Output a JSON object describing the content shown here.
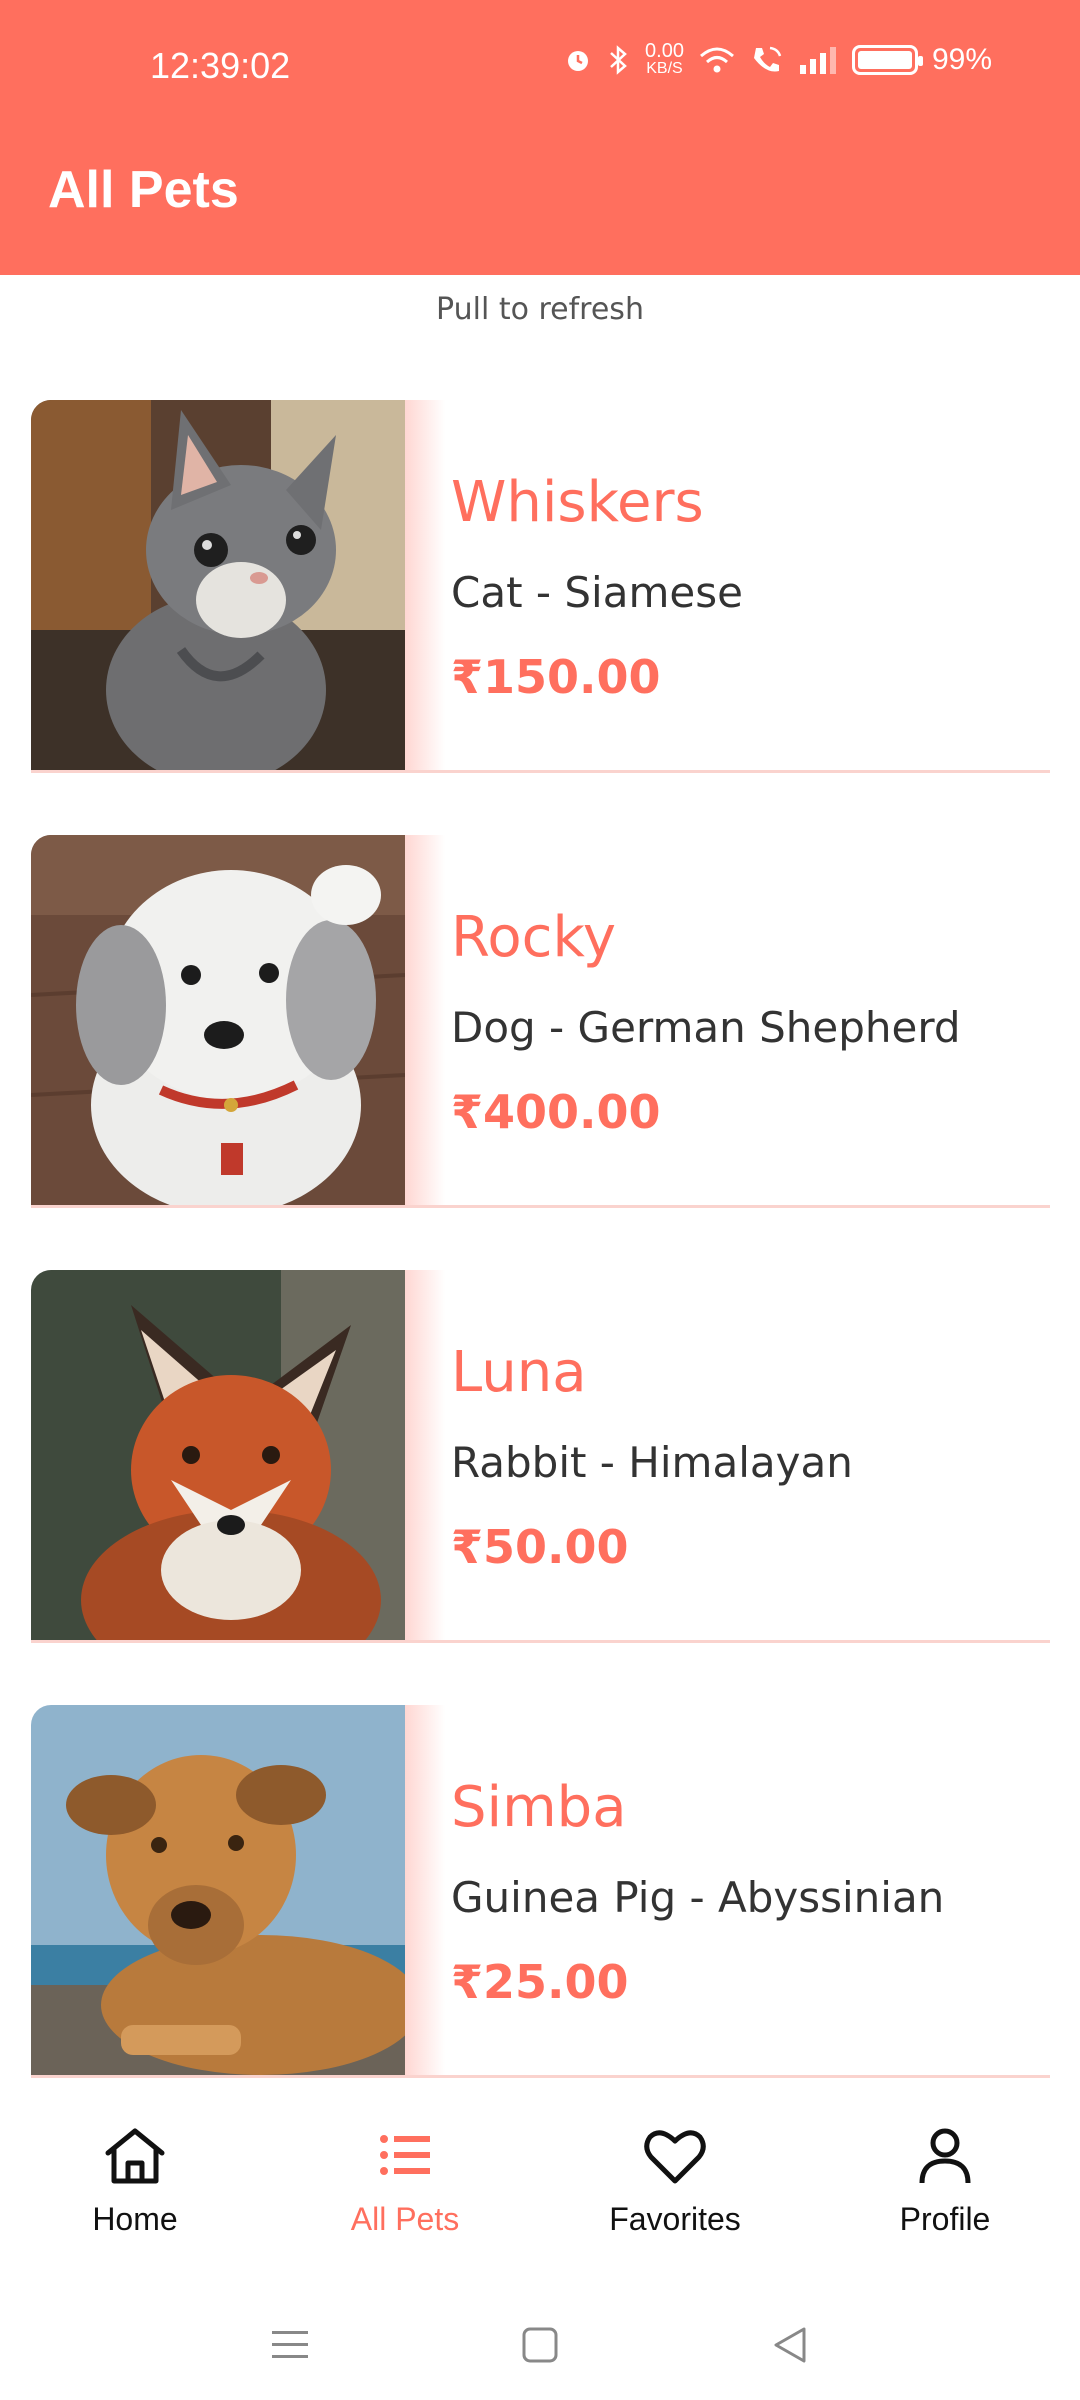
{
  "status_bar": {
    "time": "12:39:02",
    "net_speed_value": "0.00",
    "net_speed_unit": "KB/S",
    "battery": "99%"
  },
  "header": {
    "title": "All Pets"
  },
  "pull_hint": "Pull to refresh",
  "pets": [
    {
      "name": "Whiskers",
      "breed": "Cat - Siamese",
      "price": "₹150.00"
    },
    {
      "name": "Rocky",
      "breed": "Dog - German Shepherd",
      "price": "₹400.00"
    },
    {
      "name": "Luna",
      "breed": "Rabbit - Himalayan",
      "price": "₹50.00"
    },
    {
      "name": "Simba",
      "breed": "Guinea Pig - Abyssinian",
      "price": "₹25.00"
    }
  ],
  "bottom_nav": {
    "home": "Home",
    "all_pets": "All Pets",
    "favorites": "Favorites",
    "profile": "Profile"
  },
  "colors": {
    "accent": "#FF6F5E",
    "divider": "#FAD3CE"
  }
}
